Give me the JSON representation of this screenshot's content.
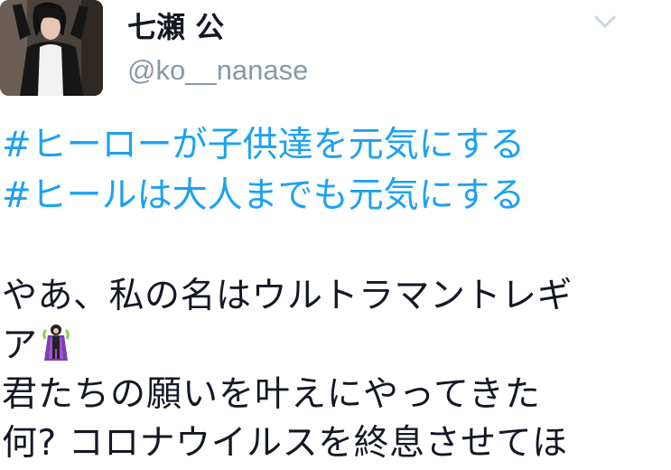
{
  "author": {
    "display_name": "七瀬 公",
    "handle": "@ko__nanase"
  },
  "tweet": {
    "hashtags": [
      "#ヒーローが子供達を元気にする",
      "#ヒールは大人までも元気にする"
    ],
    "lines": [
      "やあ、私の名はウルトラマントレギ",
      "ア",
      "君たちの願いを叶えにやってきた",
      "何? コロナウイルスを終息させてほ"
    ],
    "emoji_icon": "villain-character-emoji"
  },
  "icons": {
    "menu": "chevron-down-icon"
  },
  "colors": {
    "hashtag": "#1da1f2",
    "text": "#141823",
    "handle": "#8899a6",
    "caret": "#ccd6dd"
  }
}
